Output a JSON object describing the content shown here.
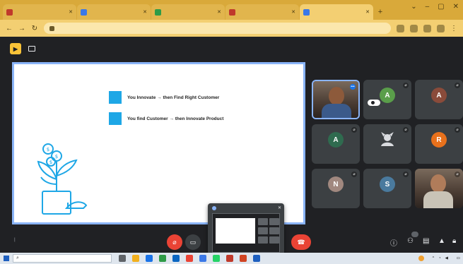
{
  "browser": {
    "tabs": [
      {
        "title": "",
        "favicon_color": "#c0392b"
      },
      {
        "title": "",
        "favicon_color": "#3b78e7"
      },
      {
        "title": "",
        "favicon_color": "#2e9b47"
      },
      {
        "title": "",
        "favicon_color": "#c0392b"
      },
      {
        "title": "",
        "favicon_color": "#3b78e7"
      }
    ],
    "url": ""
  },
  "meeting": {
    "presenter_label": "",
    "time": "",
    "code": ""
  },
  "slide": {
    "bullets": [
      "You Innovate → then Find Right Customer",
      "You find Customer → then Innovate Product"
    ]
  },
  "participants": [
    {
      "name": "",
      "initial": "",
      "avatar_color": "#8d5a3b",
      "has_video": true,
      "speaking": true
    },
    {
      "name": "",
      "initial": "A",
      "avatar_color": "#5a9e4a",
      "has_video": false,
      "pinned_label": ""
    },
    {
      "name": "",
      "initial": "A",
      "avatar_color": "#8a4b3a",
      "has_video": false
    },
    {
      "name": "",
      "initial": "A",
      "avatar_color": "#2f6b4f",
      "has_video": false
    },
    {
      "name": "",
      "initial": "",
      "avatar_color": "#9aa0a6",
      "has_video": false
    },
    {
      "name": "",
      "initial": "R",
      "avatar_color": "#e8711c",
      "has_video": false
    },
    {
      "name": "",
      "initial": "N",
      "avatar_color": "#a1887f",
      "has_video": false
    },
    {
      "name": "",
      "initial": "S",
      "avatar_color": "#4a7a9e",
      "has_video": false
    },
    {
      "name": "",
      "initial": "",
      "avatar_color": "#b07c5a",
      "has_video": true
    }
  ],
  "controls": {
    "people_count": ""
  },
  "preview_popup": {
    "title": ""
  },
  "taskbar": {
    "search_placeholder": "",
    "weather": "",
    "time": "",
    "date": ""
  },
  "colors": {
    "accent": "#8ab4f8",
    "danger": "#ea4335",
    "slide_bullet": "#1ea7e6"
  }
}
